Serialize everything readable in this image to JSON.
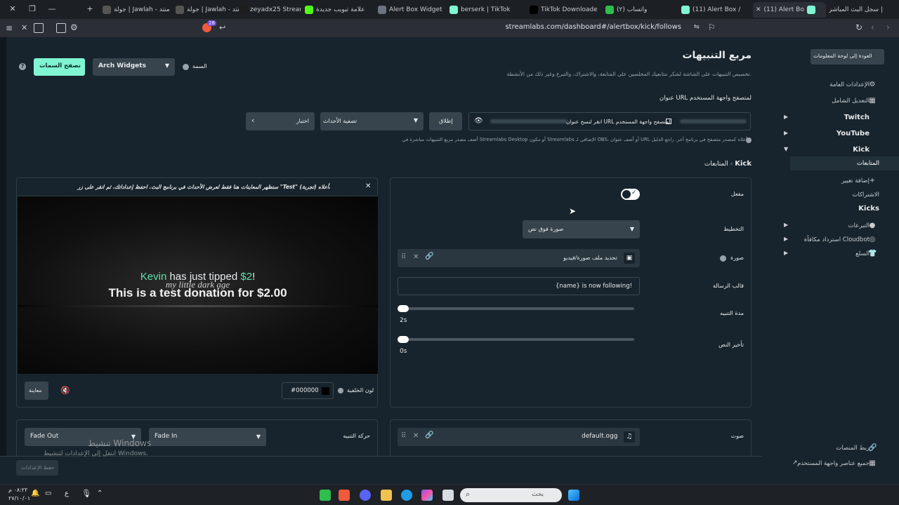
{
  "browser": {
    "tabs": [
      {
        "label": "سجل البث المباشر |"
      },
      {
        "label": "(11) Alert Bo"
      },
      {
        "label": "(11) Alert Box /"
      },
      {
        "label": "(٢) واتساب"
      },
      {
        "label": "TikTok Downloader"
      },
      {
        "label": "berserk | TikTok"
      },
      {
        "label": "Alert Box Widget"
      },
      {
        "label": "علامة تبويب جديدة"
      },
      {
        "label": "zeyadx25 Stream -"
      },
      {
        "label": "جولة | Jawlah - منتد"
      },
      {
        "label": "جولة | Jawlah - منتد"
      }
    ],
    "url": "streamlabs.com/dashboard#/alertbox/kick/follows",
    "badge_count": "28"
  },
  "header": {
    "title": "مربع التنبيهات",
    "description": "تخصيص التنبيهات على الشاشة لشكر متابعيك المخلصين على المتابعة، والاشتراك، والتبرع وغير ذلك من الأنشطة.",
    "back_button": "العودة إلى لوحة المعلومات",
    "theme_label": "السمة",
    "theme_value": "Arch Widgets",
    "browse_themes": "تصفح السمات"
  },
  "url_section": {
    "label": "عنوان URL لمتصفح واجهة المستخدم",
    "copy_text": "انقر لنسخ عنوان URL لمتصفح واجهة المستخدم",
    "launch": "إطلاق",
    "events_filter": "تصفية الأحداث",
    "test": "اختبار",
    "help_text": "أضف مصدر مربع التنبيهات مباشرة في Streamlabs Desktop أو مكون Streamlabs الإضافي لـ OBS، أو أضف عنوان URL أعلاه كمصدر متصفح في برنامج آخر. راجع الدليل"
  },
  "breadcrumb": {
    "root": "Kick",
    "current": "المتابعات"
  },
  "preview": {
    "notice": "ستظهر المعاينات هنا فقط لعرض الأحداث في برنامج البث. احفظ إعداداتك، ثم انقر على زر \"Test\" (تجربة) أعلاه.",
    "name": "Kevin",
    "tip_text": " has just tipped ",
    "amount": "$2",
    "exclaim": "!",
    "message": "This is a test donation for $2.00",
    "watermark": "my little dark age",
    "bg_color_label": "لون الخلفية",
    "bg_color_value": "#000000",
    "compare_button": "معاينة"
  },
  "settings": {
    "enabled_label": "مفعل",
    "layout_label": "التخطيط",
    "layout_value": "صورة فوق نص",
    "image_label": "صورة",
    "image_select": "تحديد ملف صورة/فيديو",
    "message_template_label": "قالب الرسالة",
    "message_template_value": "{name} is now following!",
    "duration_label": "مدة التنبيه",
    "duration_value": "2s",
    "text_delay_label": "تأخير النص",
    "text_delay_value": "0s",
    "sound_label": "صوت",
    "sound_value": "default.ogg"
  },
  "animation": {
    "label": "حركة التنبيه",
    "in_value": "Fade In",
    "out_value": "Fade Out"
  },
  "sidebar": {
    "general": "الإعدادات العامة",
    "advanced": "التعديل الشامل",
    "twitch": "Twitch",
    "youtube": "YouTube",
    "kick": "Kick",
    "follows": "المتابعات",
    "add_variation": "إضافة تغيير",
    "subscriptions": "الاشتراكات",
    "kicks": "Kicks",
    "donations": "التبرعات",
    "cloudbot": "استرداد مكافأة Cloudbot",
    "merch": "السلع",
    "connect": "ربط المنصات",
    "all_widgets": "جميع عناصر واجهة المستخدم"
  },
  "footer": {
    "save": "حفظ الإعدادات",
    "watermark_title": "تنشيط Windows",
    "watermark_sub": "انتقل إلى الإعدادات لتنشيط Windows."
  },
  "taskbar": {
    "search_placeholder": "بحث",
    "time": "٠٨:٢٢ م",
    "date": "٢٧/١٠/٠١",
    "lang": "ع"
  },
  "colors": {
    "accent": "#80f5d2",
    "background": "#17242d",
    "kevin": "#5ee0a8"
  }
}
